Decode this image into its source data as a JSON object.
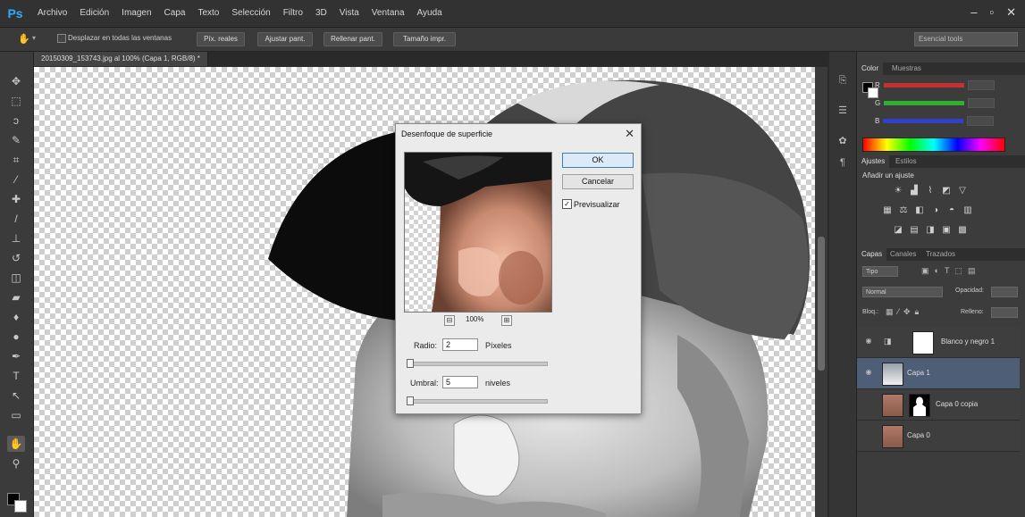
{
  "app": {
    "logo": "Ps"
  },
  "menu": [
    "Archivo",
    "Edición",
    "Imagen",
    "Capa",
    "Texto",
    "Selección",
    "Filtro",
    "3D",
    "Vista",
    "Ventana",
    "Ayuda"
  ],
  "window_controls": [
    "–",
    "▫",
    "✕"
  ],
  "options_bar": {
    "scroll_all_windows": "Desplazar en todas las ventanas",
    "buttons": [
      "Píx. reales",
      "Ajustar pant.",
      "Rellenar pant.",
      "Tamaño impr."
    ],
    "search_placeholder": "Esencial tools"
  },
  "document_tab": "20150309_153743.jpg al 100% (Capa 1, RGB/8) *",
  "dialog": {
    "title": "Desenfoque de superficie",
    "close": "✕",
    "ok_label": "OK",
    "cancel_label": "Cancelar",
    "preview_label": "Previsualizar",
    "preview_checked": true,
    "zoom_out": "⊟",
    "zoom_in": "⊞",
    "zoom_value": "100%",
    "radius_label": "Radio:",
    "radius_value": "2",
    "radius_unit": "Píxeles",
    "radius_slider": 0.0,
    "threshold_label": "Umbral:",
    "threshold_value": "5",
    "threshold_unit": "niveles",
    "threshold_slider": 0.0
  },
  "panels": {
    "color_tabs": [
      "Color",
      "Muestras"
    ],
    "color_rows": [
      {
        "channel": "R",
        "bar": "#c83030"
      },
      {
        "channel": "G",
        "bar": "#30b030"
      },
      {
        "channel": "B",
        "bar": "#3040c8"
      }
    ],
    "adjust_tabs": [
      "Ajustes",
      "Estilos"
    ],
    "adjust_title": "Añadir un ajuste",
    "layers_tabs": [
      "Capas",
      "Canales",
      "Trazados"
    ],
    "kind_filter": "Tipo",
    "blend_mode": "Normal",
    "opacity_label": "Opacidad:",
    "lock_label": "Bloq.:",
    "fill_label": "Relleno:",
    "layers": [
      {
        "name": "Blanco y negro 1",
        "selected": false
      },
      {
        "name": "Capa 1",
        "selected": true
      },
      {
        "name": "Capa 0 copia",
        "selected": false
      },
      {
        "name": "Capa 0",
        "selected": false
      }
    ]
  }
}
